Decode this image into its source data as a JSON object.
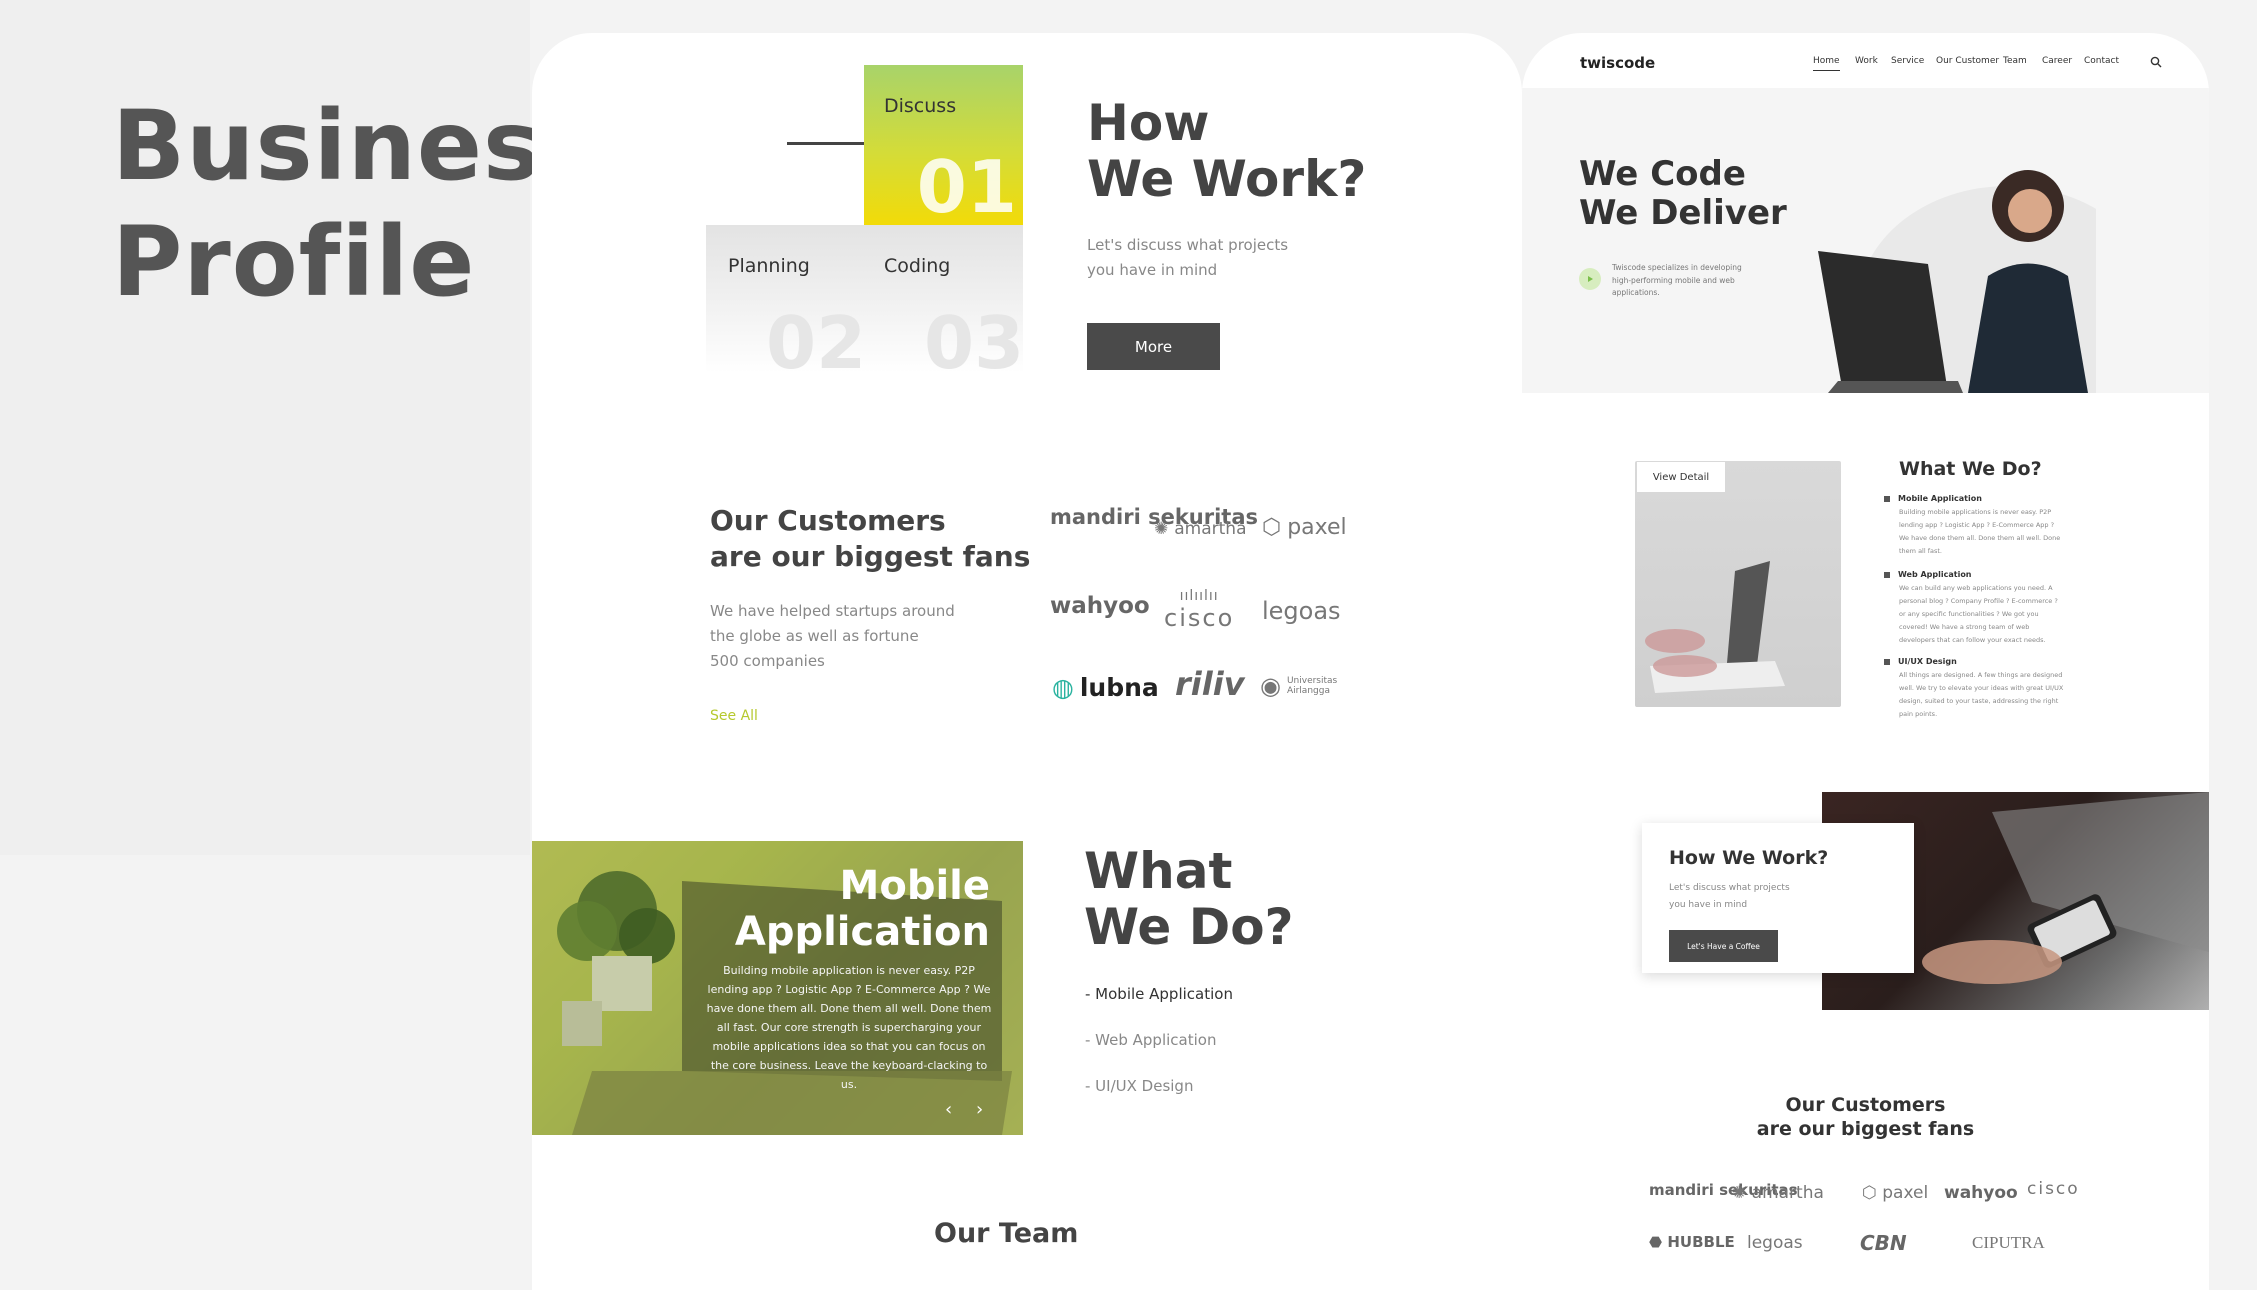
{
  "page_title": [
    "Business",
    "Profile"
  ],
  "left": {
    "how": {
      "steps": [
        {
          "label": "Discuss",
          "num": "01"
        },
        {
          "label": "Planning",
          "num": "02"
        },
        {
          "label": "Coding",
          "num": "03"
        }
      ],
      "title": [
        "How",
        "We Work?"
      ],
      "subtitle": [
        "Let's discuss what projects",
        "you have in mind"
      ],
      "button": "More"
    },
    "customers": {
      "title": [
        "Our Customers",
        "are our biggest fans"
      ],
      "subtitle": [
        "We have helped startups around",
        "the globe as well as fortune",
        "500 companies"
      ],
      "see_all": "See All",
      "logos": [
        "mandiri sekuritas",
        "amartha",
        "paxel",
        "wahyoo",
        "cisco",
        "legoas",
        "lubna",
        "riliv",
        "Universitas Airlangga"
      ]
    },
    "mobile": {
      "title": [
        "Mobile",
        "Application"
      ],
      "body": "Building mobile application is never easy. P2P lending app ? Logistic App ? E-Commerce App ? We have done them all. Done them all well. Done them all fast. Our core strength is supercharging your mobile applications idea so that you can focus on the core business. Leave the keyboard-clacking to us.",
      "prev": "‹",
      "next": "›"
    },
    "what": {
      "title": [
        "What",
        "We Do?"
      ],
      "items": [
        "- Mobile Application",
        "- Web Application",
        "- UI/UX Design"
      ]
    },
    "team_title": "Our Team"
  },
  "right": {
    "nav": {
      "logo": "twiscode",
      "items": [
        "Home",
        "Work",
        "Service",
        "Our Customer",
        "Team",
        "Career",
        "Contact"
      ]
    },
    "hero": {
      "title": [
        "We Code",
        "We Deliver"
      ],
      "text": "Twiscode specializes in developing high-performing mobile and web applications."
    },
    "services": {
      "view_detail": "View Detail",
      "title": "What We Do?",
      "items": [
        {
          "head": "Mobile Application",
          "desc": "Building mobile applications is never easy. P2P lending app ? Logistic App ? E-Commerce App ? We have done them all. Done them all well. Done them all fast."
        },
        {
          "head": "Web Application",
          "desc": "We can build any web applications you need. A personal blog ? Company Profile ? E-commerce ? or any specific functionalities ? We got you covered! We have a strong team of web developers that can follow your exact needs."
        },
        {
          "head": "UI/UX Design",
          "desc": "All things are designed. A few things are designed well. We try to elevate your ideas with great UI/UX design, suited to your taste, addressing the right pain points."
        }
      ]
    },
    "how": {
      "title": "How We Work?",
      "subtitle": [
        "Let's discuss what projects",
        "you have in mind"
      ],
      "button": "Let's Have a Coffee"
    },
    "customers": {
      "title": [
        "Our Customers",
        "are our biggest fans"
      ],
      "logos_row1": [
        "mandiri sekuritas",
        "amartha",
        "paxel",
        "wahyoo",
        "cisco"
      ],
      "logos_row2": [
        "HUBBLE",
        "legoas",
        "CBN",
        "CIPUTRA"
      ]
    }
  }
}
